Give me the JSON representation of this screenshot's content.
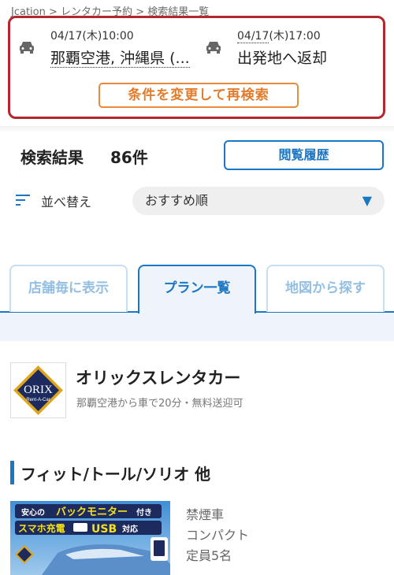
{
  "breadcrumb": {
    "items": [
      "Jcation",
      "レンタカー予約",
      "検索結果一覧"
    ],
    "separator": ">"
  },
  "search": {
    "pickup_datetime_prefix": "04/17",
    "pickup_datetime_suffix": "(木)10:00",
    "pickup_location": "那覇空港, 沖縄県 (...",
    "return_datetime_prefix": "04/17",
    "return_datetime_suffix": "(木)17:00",
    "return_location": "出発地へ返却",
    "research_label": "条件を変更して再検索"
  },
  "results": {
    "title": "検索結果",
    "count": "86件",
    "history_label": "閲覧履歴"
  },
  "sort": {
    "label": "並べ替え",
    "selected": "おすすめ順"
  },
  "tabs": [
    {
      "label": "店舗毎に表示",
      "active": false
    },
    {
      "label": "プラン一覧",
      "active": true
    },
    {
      "label": "地図から探す",
      "active": false
    }
  ],
  "shop": {
    "logo_text_main": "ORIX",
    "logo_text_sub": "Rent-A-Car",
    "name": "オリックスレンタカー",
    "access": "那覇空港から車で20分・無料送迎可"
  },
  "plan": {
    "car_class": "フィット/トール/ソリオ 他",
    "photo_banner_1_prefix": "安心の",
    "photo_banner_1_highlight": "バックモニター",
    "photo_banner_1_suffix": "付き",
    "photo_banner_2_prefix": "スマホ充電",
    "photo_banner_2_highlight": "USB",
    "photo_banner_2_suffix": "対応",
    "attributes": [
      "禁煙車",
      "コンパクト",
      "定員5名"
    ]
  },
  "colors": {
    "accent_blue": "#1b76c4",
    "research_orange": "#e8893c",
    "highlight_red": "#b3272f"
  }
}
